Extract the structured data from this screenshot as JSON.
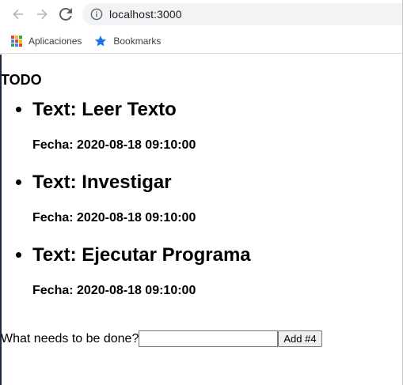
{
  "browser": {
    "url": "localhost:3000",
    "bookmarks": [
      {
        "label": "Aplicaciones",
        "icon": "apps-grid-icon"
      },
      {
        "label": "Bookmarks",
        "icon": "star-icon"
      }
    ]
  },
  "page": {
    "title": "TODO",
    "items": [
      {
        "text": "Text: Leer Texto",
        "date": "Fecha: 2020-08-18 09:10:00"
      },
      {
        "text": "Text: Investigar",
        "date": "Fecha: 2020-08-18 09:10:00"
      },
      {
        "text": "Text: Ejecutar Programa",
        "date": "Fecha: 2020-08-18 09:10:00"
      }
    ],
    "form": {
      "label": "What needs to be done?",
      "input_value": "",
      "button_label": "Add #4"
    }
  },
  "colors": {
    "star": "#1a73e8",
    "omnibox_bg": "#f1f3f4"
  }
}
